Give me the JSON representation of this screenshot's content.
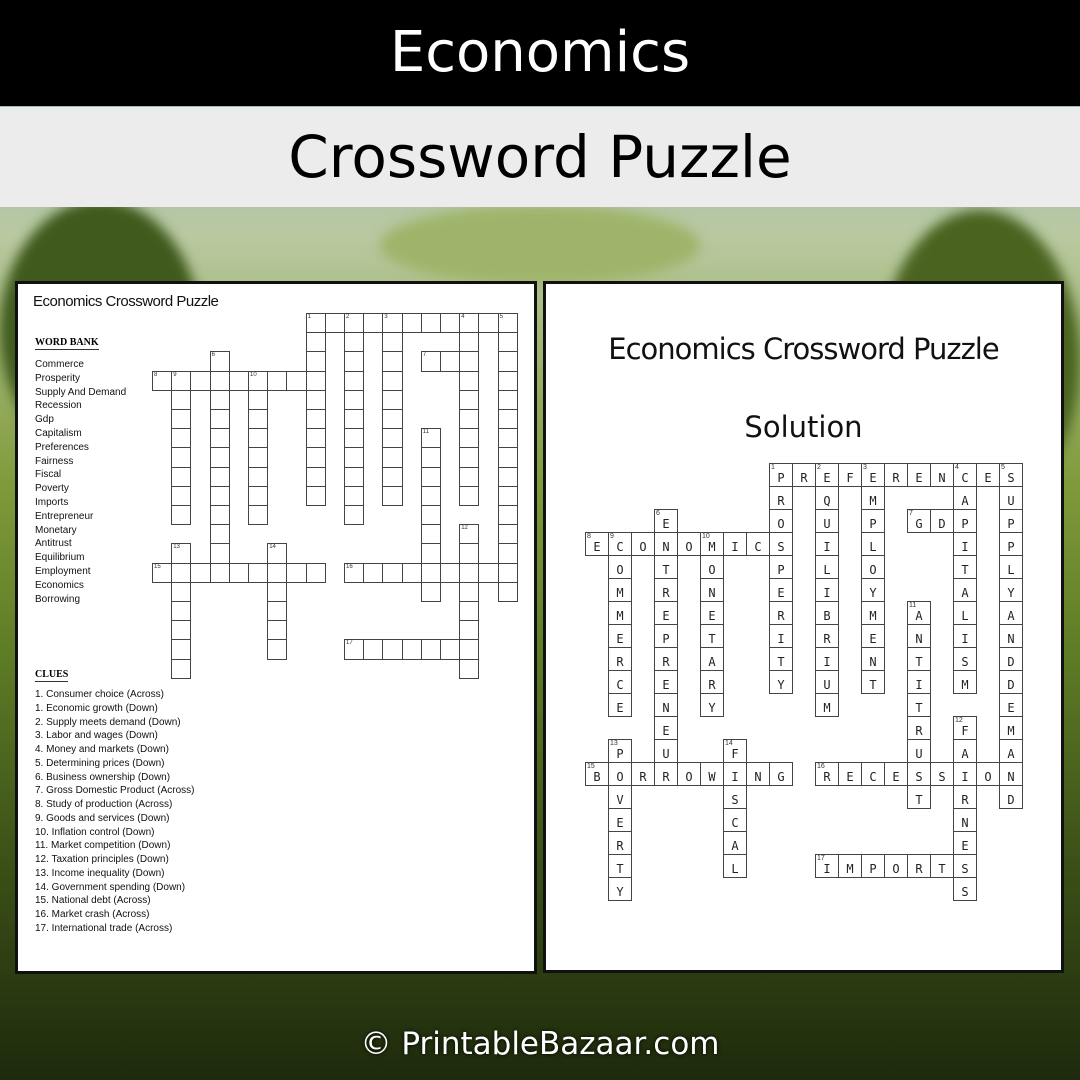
{
  "header": {
    "title": "Economics",
    "subtitle": "Crossword Puzzle"
  },
  "puzzle_page": {
    "title": "Economics Crossword Puzzle",
    "word_bank_heading": "WORD BANK",
    "word_bank": [
      "Commerce",
      "Prosperity",
      "Supply And Demand",
      "Recession",
      "Gdp",
      "Capitalism",
      "Preferences",
      "Fairness",
      "Fiscal",
      "Poverty",
      "Imports",
      "Entrepreneur",
      "Monetary",
      "Antitrust",
      "Equilibrium",
      "Employment",
      "Economics",
      "Borrowing"
    ],
    "clues_heading": "CLUES",
    "clues": [
      "1. Consumer choice (Across)",
      "1. Economic growth  (Down)",
      "2. Supply meets demand (Down)",
      "3. Labor and wages (Down)",
      "4. Money and markets (Down)",
      "5. Determining prices (Down)",
      "6. Business ownership (Down)",
      "7. Gross Domestic Product (Across)",
      "8. Study of production  (Across)",
      "9. Goods and services (Down)",
      "10. Inflation control (Down)",
      "11. Market  competition  (Down)",
      "12. Taxation principles (Down)",
      "13. Income inequality (Down)",
      "14. Government  spending (Down)",
      "15. National debt (Across)",
      "16. Market  crash (Across)",
      "17. International trade (Across)"
    ]
  },
  "solution_page": {
    "title": "Economics Crossword Puzzle",
    "subtitle": "Solution"
  },
  "crossword": {
    "grid_cols": 19,
    "grid_rows": 19,
    "words": [
      {
        "num": 1,
        "dir": "across",
        "col": 8,
        "row": 0,
        "answer": "PREFERENCES"
      },
      {
        "num": 1,
        "dir": "down",
        "col": 8,
        "row": 0,
        "answer": "PROSPERITY"
      },
      {
        "num": 2,
        "dir": "down",
        "col": 10,
        "row": 0,
        "answer": "EQUILIBRIUM"
      },
      {
        "num": 3,
        "dir": "down",
        "col": 12,
        "row": 0,
        "answer": "EMPLOYMENT"
      },
      {
        "num": 4,
        "dir": "down",
        "col": 16,
        "row": 0,
        "answer": "CAPITALISM"
      },
      {
        "num": 5,
        "dir": "down",
        "col": 18,
        "row": 0,
        "answer": "SUPPLYANDDEMAND"
      },
      {
        "num": 6,
        "dir": "down",
        "col": 3,
        "row": 2,
        "answer": "ENTREPRENEUR"
      },
      {
        "num": 7,
        "dir": "across",
        "col": 14,
        "row": 2,
        "answer": "GDP"
      },
      {
        "num": 8,
        "dir": "across",
        "col": 0,
        "row": 3,
        "answer": "ECONOMICS"
      },
      {
        "num": 9,
        "dir": "down",
        "col": 1,
        "row": 3,
        "answer": "COMMERCE"
      },
      {
        "num": 10,
        "dir": "down",
        "col": 5,
        "row": 3,
        "answer": "MONETARY"
      },
      {
        "num": 11,
        "dir": "down",
        "col": 14,
        "row": 6,
        "answer": "ANTITRUST"
      },
      {
        "num": 12,
        "dir": "down",
        "col": 16,
        "row": 11,
        "answer": "FAIRNESS"
      },
      {
        "num": 13,
        "dir": "down",
        "col": 1,
        "row": 12,
        "answer": "POVERTY"
      },
      {
        "num": 14,
        "dir": "down",
        "col": 6,
        "row": 12,
        "answer": "FISCAL"
      },
      {
        "num": 15,
        "dir": "across",
        "col": 0,
        "row": 13,
        "answer": "BORROWING"
      },
      {
        "num": 16,
        "dir": "across",
        "col": 10,
        "row": 13,
        "answer": "RECESSION"
      },
      {
        "num": 17,
        "dir": "across",
        "col": 10,
        "row": 17,
        "answer": "IMPORTS"
      }
    ]
  },
  "footer": {
    "copyright": "© PrintableBazaar.com"
  }
}
